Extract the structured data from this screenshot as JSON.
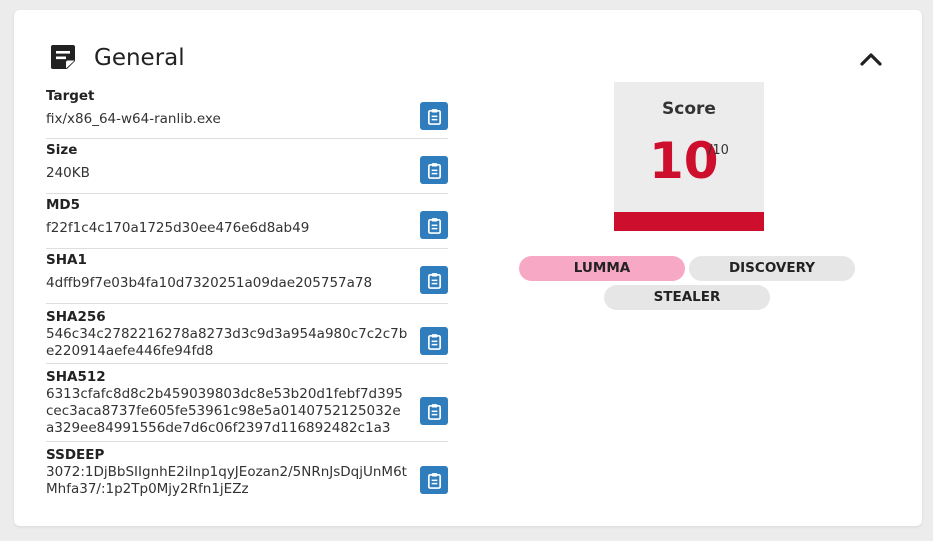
{
  "section": {
    "title": "General"
  },
  "fields": [
    {
      "label": "Target",
      "value": "fix/x86_64-w64-ranlib.exe"
    },
    {
      "label": "Size",
      "value": "240KB"
    },
    {
      "label": "MD5",
      "value": "f22f1c4c170a1725d30ee476e6d8ab49"
    },
    {
      "label": "SHA1",
      "value": "4dffb9f7e03b4fa10d7320251a09dae205757a78"
    },
    {
      "label": "SHA256",
      "value": "546c34c2782216278a8273d3c9d3a954a980c7c2c7be220914aefe446fe94fd8"
    },
    {
      "label": "SHA512",
      "value": "6313cfafc8d8c2b459039803dc8e53b20d1febf7d395cec3aca8737fe605fe53961c98e5a0140752125032ea329ee84991556de7d6c06f2397d116892482c1a3"
    },
    {
      "label": "SSDEEP",
      "value": "3072:1DjBbSIIgnhE2iInp1qyJEozan2/5NRnJsDqjUnM6tMhfa37/:1p2Tp0Mjy2Rfn1jEZz"
    }
  ],
  "score": {
    "label": "Score",
    "value": "10",
    "max": "/10",
    "color": "#cd0e2c"
  },
  "tags": [
    {
      "label": "LUMMA",
      "color": "#f7a8c4"
    },
    {
      "label": "DISCOVERY",
      "color": "#e6e6e6"
    },
    {
      "label": "STEALER",
      "color": "#e6e6e6"
    }
  ],
  "icons": {
    "header": "note-icon",
    "collapse": "chevron-up-icon",
    "copy": "clipboard-icon"
  },
  "colors": {
    "accent": "#2f7dbd",
    "danger": "#cd0e2c",
    "tag_primary": "#f7a8c4",
    "tag_default": "#e6e6e6"
  }
}
